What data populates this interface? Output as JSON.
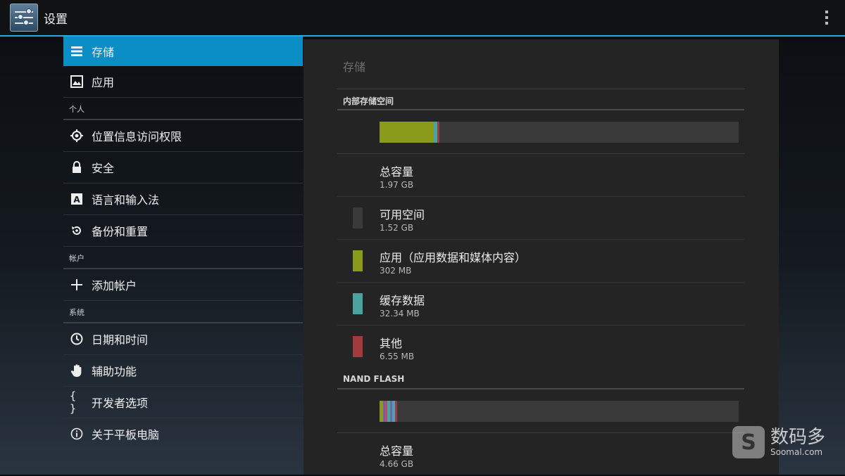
{
  "app": {
    "title": "设置",
    "icon": "settings-icon"
  },
  "nav": {
    "items": [
      {
        "label": "存储",
        "icon": "storage-icon",
        "selected": true
      },
      {
        "label": "应用",
        "icon": "apps-icon"
      }
    ],
    "sections": [
      {
        "header": "个人",
        "items": [
          {
            "label": "位置信息访问权限",
            "icon": "location-icon"
          },
          {
            "label": "安全",
            "icon": "lock-icon"
          },
          {
            "label": "语言和输入法",
            "icon": "language-icon"
          },
          {
            "label": "备份和重置",
            "icon": "backup-icon"
          }
        ]
      },
      {
        "header": "帐户",
        "items": [
          {
            "label": "添加帐户",
            "icon": "add-icon"
          }
        ]
      },
      {
        "header": "系统",
        "items": [
          {
            "label": "日期和时间",
            "icon": "clock-icon"
          },
          {
            "label": "辅助功能",
            "icon": "hand-icon"
          },
          {
            "label": "开发者选项",
            "icon": "braces-icon"
          },
          {
            "label": "关于平板电脑",
            "icon": "info-icon"
          }
        ]
      }
    ]
  },
  "content": {
    "title": "存储",
    "internal": {
      "header": "内部存储空间",
      "bar_segments": [
        {
          "name": "apps",
          "fraction": 0.151,
          "color": "#8a9a1a"
        },
        {
          "name": "cache",
          "fraction": 0.01,
          "color": "#4aa3a0"
        },
        {
          "name": "other",
          "fraction": 0.005,
          "color": "#a13a3a"
        }
      ],
      "rows": [
        {
          "label": "总容量",
          "value": "1.97 GB",
          "swatch": null
        },
        {
          "label": "可用空间",
          "value": "1.52 GB",
          "swatch": "#3a3a3a"
        },
        {
          "label": "应用（应用数据和媒体内容）",
          "value": "302 MB",
          "swatch": "#8a9a1a"
        },
        {
          "label": "缓存数据",
          "value": "32.34 MB",
          "swatch": "#4aa3a0"
        },
        {
          "label": "其他",
          "value": "6.55 MB",
          "swatch": "#a13a3a"
        }
      ]
    },
    "nand": {
      "header": "NAND FLASH",
      "bar_segments": [
        {
          "name": "a",
          "fraction": 0.01,
          "color": "#8a9a1a"
        },
        {
          "name": "b",
          "fraction": 0.006,
          "color": "#7a5aa0"
        },
        {
          "name": "c",
          "fraction": 0.006,
          "color": "#b0506a"
        },
        {
          "name": "d",
          "fraction": 0.008,
          "color": "#4aa3a0"
        },
        {
          "name": "e",
          "fraction": 0.006,
          "color": "#6a6aa8"
        },
        {
          "name": "f",
          "fraction": 0.008,
          "color": "#48a0c0"
        },
        {
          "name": "g",
          "fraction": 0.006,
          "color": "#a13a3a"
        }
      ],
      "rows": [
        {
          "label": "总容量",
          "value": "4.66 GB"
        }
      ]
    }
  },
  "watermark": {
    "logo": "S",
    "cn": "数码多",
    "en": "Soomal.com"
  }
}
